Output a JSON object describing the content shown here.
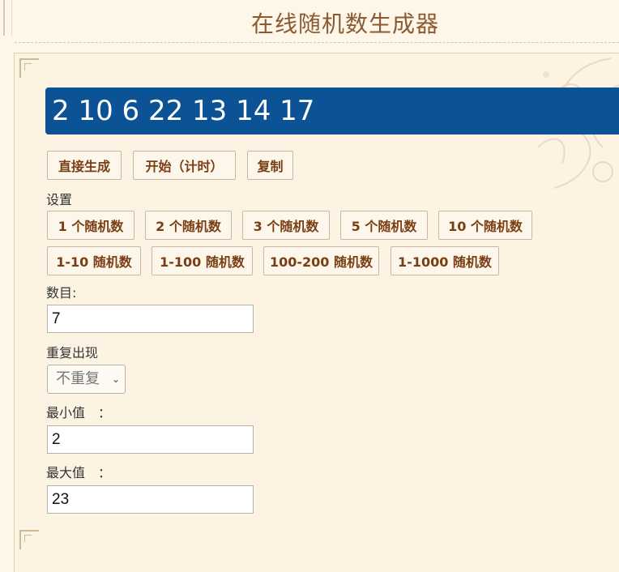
{
  "page": {
    "title": "在线随机数生成器"
  },
  "result": {
    "text": "2 10 6 22 13 14 17"
  },
  "actions": {
    "generate": "直接生成",
    "start_timed": "开始（计时）",
    "copy": "复制"
  },
  "settings": {
    "label": "设置",
    "presets_count": [
      "1 个随机数",
      "2 个随机数",
      "3 个随机数",
      "5 个随机数",
      "10 个随机数"
    ],
    "presets_range": [
      "1-10 随机数",
      "1-100 随机数",
      "100-200 随机数",
      "1-1000 随机数"
    ]
  },
  "form": {
    "count_label": "数目:",
    "count_value": "7",
    "repeat_label": "重复出现",
    "repeat_selected": "不重复",
    "min_label": "最小值　：",
    "min_value": "2",
    "max_label": "最大值　：",
    "max_value": "23"
  }
}
